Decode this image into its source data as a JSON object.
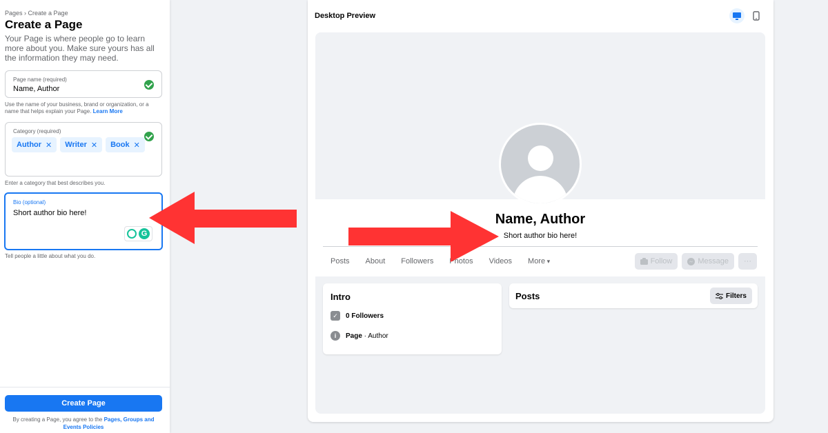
{
  "left": {
    "breadcrumb_root": "Pages",
    "breadcrumb_sep": " › ",
    "breadcrumb_current": "Create a Page",
    "title": "Create a Page",
    "description": "Your Page is where people go to learn more about you. Make sure yours has all the information they may need.",
    "name_field": {
      "label": "Page name (required)",
      "value": "Name, Author",
      "helper": "Use the name of your business, brand or organization, or a name that helps explain your Page.",
      "helper_link": "Learn More"
    },
    "category_field": {
      "label": "Category (required)",
      "chips": [
        "Author",
        "Writer",
        "Book"
      ],
      "chip_remove": "✕",
      "helper": "Enter a category that best describes you."
    },
    "bio_field": {
      "label": "Bio (optional)",
      "value": "Short author bio here!",
      "helper": "Tell people a little about what you do.",
      "grammarly_letter": "G"
    },
    "create_button": "Create Page",
    "terms_text": "By creating a Page, you agree to the ",
    "terms_link": "Pages, Groups and Events Policies"
  },
  "preview": {
    "title": "Desktop Preview",
    "page_name": "Name, Author",
    "page_bio": "Short author bio here!",
    "tabs": [
      "Posts",
      "About",
      "Followers",
      "Photos",
      "Videos",
      "More"
    ],
    "actions": {
      "follow": "Follow",
      "message": "Message",
      "more": "···"
    },
    "intro": {
      "title": "Intro",
      "followers": "0 Followers",
      "page_label": "Page",
      "page_sep": " · ",
      "page_category": "Author"
    },
    "posts": {
      "title": "Posts",
      "filters": "Filters"
    }
  },
  "colors": {
    "accent": "#1877f2",
    "arrow": "#ff3333",
    "check": "#31a24c",
    "grammarly": "#15c39a"
  }
}
